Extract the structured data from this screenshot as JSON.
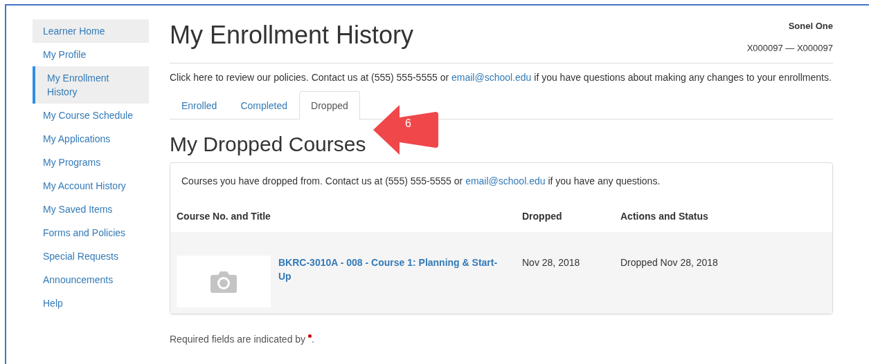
{
  "sidebar": {
    "items": [
      {
        "label": "Learner Home",
        "selected": false,
        "highlighted": true
      },
      {
        "label": "My Profile",
        "selected": false,
        "highlighted": false
      },
      {
        "label": "My Enrollment History",
        "selected": true,
        "highlighted": false
      },
      {
        "label": "My Course Schedule",
        "selected": false,
        "highlighted": false
      },
      {
        "label": "My Applications",
        "selected": false,
        "highlighted": false
      },
      {
        "label": "My Programs",
        "selected": false,
        "highlighted": false
      },
      {
        "label": "My Account History",
        "selected": false,
        "highlighted": false
      },
      {
        "label": "My Saved Items",
        "selected": false,
        "highlighted": false
      },
      {
        "label": "Forms and Policies",
        "selected": false,
        "highlighted": false
      },
      {
        "label": "Special Requests",
        "selected": false,
        "highlighted": false
      },
      {
        "label": "Announcements",
        "selected": false,
        "highlighted": false
      },
      {
        "label": "Help",
        "selected": false,
        "highlighted": false
      }
    ]
  },
  "page_title": "My Enrollment History",
  "user": {
    "name": "Sonel One",
    "id_range": "X000097 — X000097"
  },
  "notice": {
    "before": "Click here to review our policies. Contact us at (555) 555-5555 or ",
    "link": "email@school.edu",
    "after": " if you have questions about making any changes to your enrollments."
  },
  "tabs": [
    {
      "label": "Enrolled",
      "selected": false
    },
    {
      "label": "Completed",
      "selected": false
    },
    {
      "label": "Dropped",
      "selected": true
    }
  ],
  "callout": {
    "label": "6"
  },
  "section_title": "My Dropped Courses",
  "card": {
    "intro": {
      "before": "Courses you have dropped from. Contact us at (555) 555-5555 or ",
      "link": "email@school.edu",
      "after": " if you have any questions."
    },
    "columns": [
      "Course No. and Title",
      "Dropped",
      "Actions and Status"
    ],
    "rows": [
      {
        "title": "BKRC-3010A - 008 - Course 1: Planning & Start-Up",
        "dropped": "Nov 28, 2018",
        "status": "Dropped Nov 28, 2018"
      }
    ]
  },
  "footer_note": {
    "before": "Required fields are indicated by ",
    "after": "."
  }
}
